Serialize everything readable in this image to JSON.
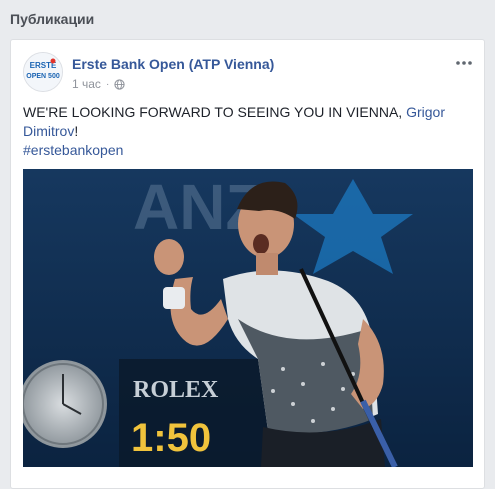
{
  "section": {
    "title": "Публикации"
  },
  "post": {
    "page_name": "Erste Bank Open (ATP Vienna)",
    "avatar_text_top": "ERSTE",
    "avatar_text_bottom": "OPEN 500",
    "time": "1 час",
    "separator": "·",
    "privacy_icon": "globe-icon",
    "more_icon": "more-horizontal-icon",
    "text_main": "WE'RE LOOKING FORWARD TO SEEING YOU IN VIENNA,",
    "text_mention": "Grigor Dimitrov",
    "text_after": "!",
    "hashtag": "#erstebankopen",
    "photo": {
      "bg_text_top": "ANZ",
      "clock_brand": "ROLEX",
      "clock_time": "1:50"
    }
  },
  "colors": {
    "link": "#365899",
    "meta": "#90949c",
    "photo_bg": "#0c2848",
    "scoreboard_digits": "#f0c33c"
  }
}
